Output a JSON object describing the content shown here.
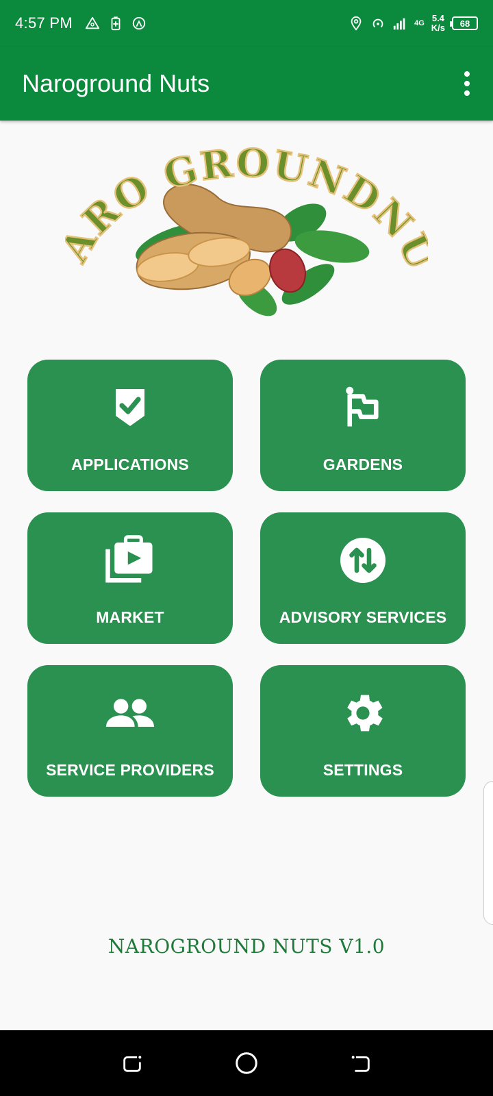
{
  "status_bar": {
    "time": "4:57 PM",
    "network_type": "4G",
    "speed_value": "5.4",
    "speed_unit": "K/s",
    "battery_level": "68",
    "icons": [
      "alert-triangle-icon",
      "battery-saver-icon",
      "hotspot-icon",
      "location-icon",
      "wifi-hotspot-icon",
      "signal-icon",
      "signal-4g-icon"
    ]
  },
  "app_bar": {
    "title": "Naroground Nuts",
    "menu_icon": "more-vert-icon"
  },
  "logo": {
    "text": "NARO GROUNDNUT"
  },
  "tiles": [
    {
      "label": "APPLICATIONS",
      "icon": "shield-check-icon"
    },
    {
      "label": "GARDENS",
      "icon": "flag-icon"
    },
    {
      "label": "MARKET",
      "icon": "video-library-icon"
    },
    {
      "label": "ADVISORY SERVICES",
      "icon": "swap-vertical-circle-icon"
    },
    {
      "label": "SERVICE PROVIDERS",
      "icon": "people-icon"
    },
    {
      "label": "SETTINGS",
      "icon": "gear-icon"
    }
  ],
  "footer": {
    "version": "NAROGROUND NUTS V1.0"
  },
  "colors": {
    "primary": "#0b8a3e",
    "tile": "#2a9150",
    "footer_text": "#1f7a3a",
    "background": "#f9f9f9"
  }
}
